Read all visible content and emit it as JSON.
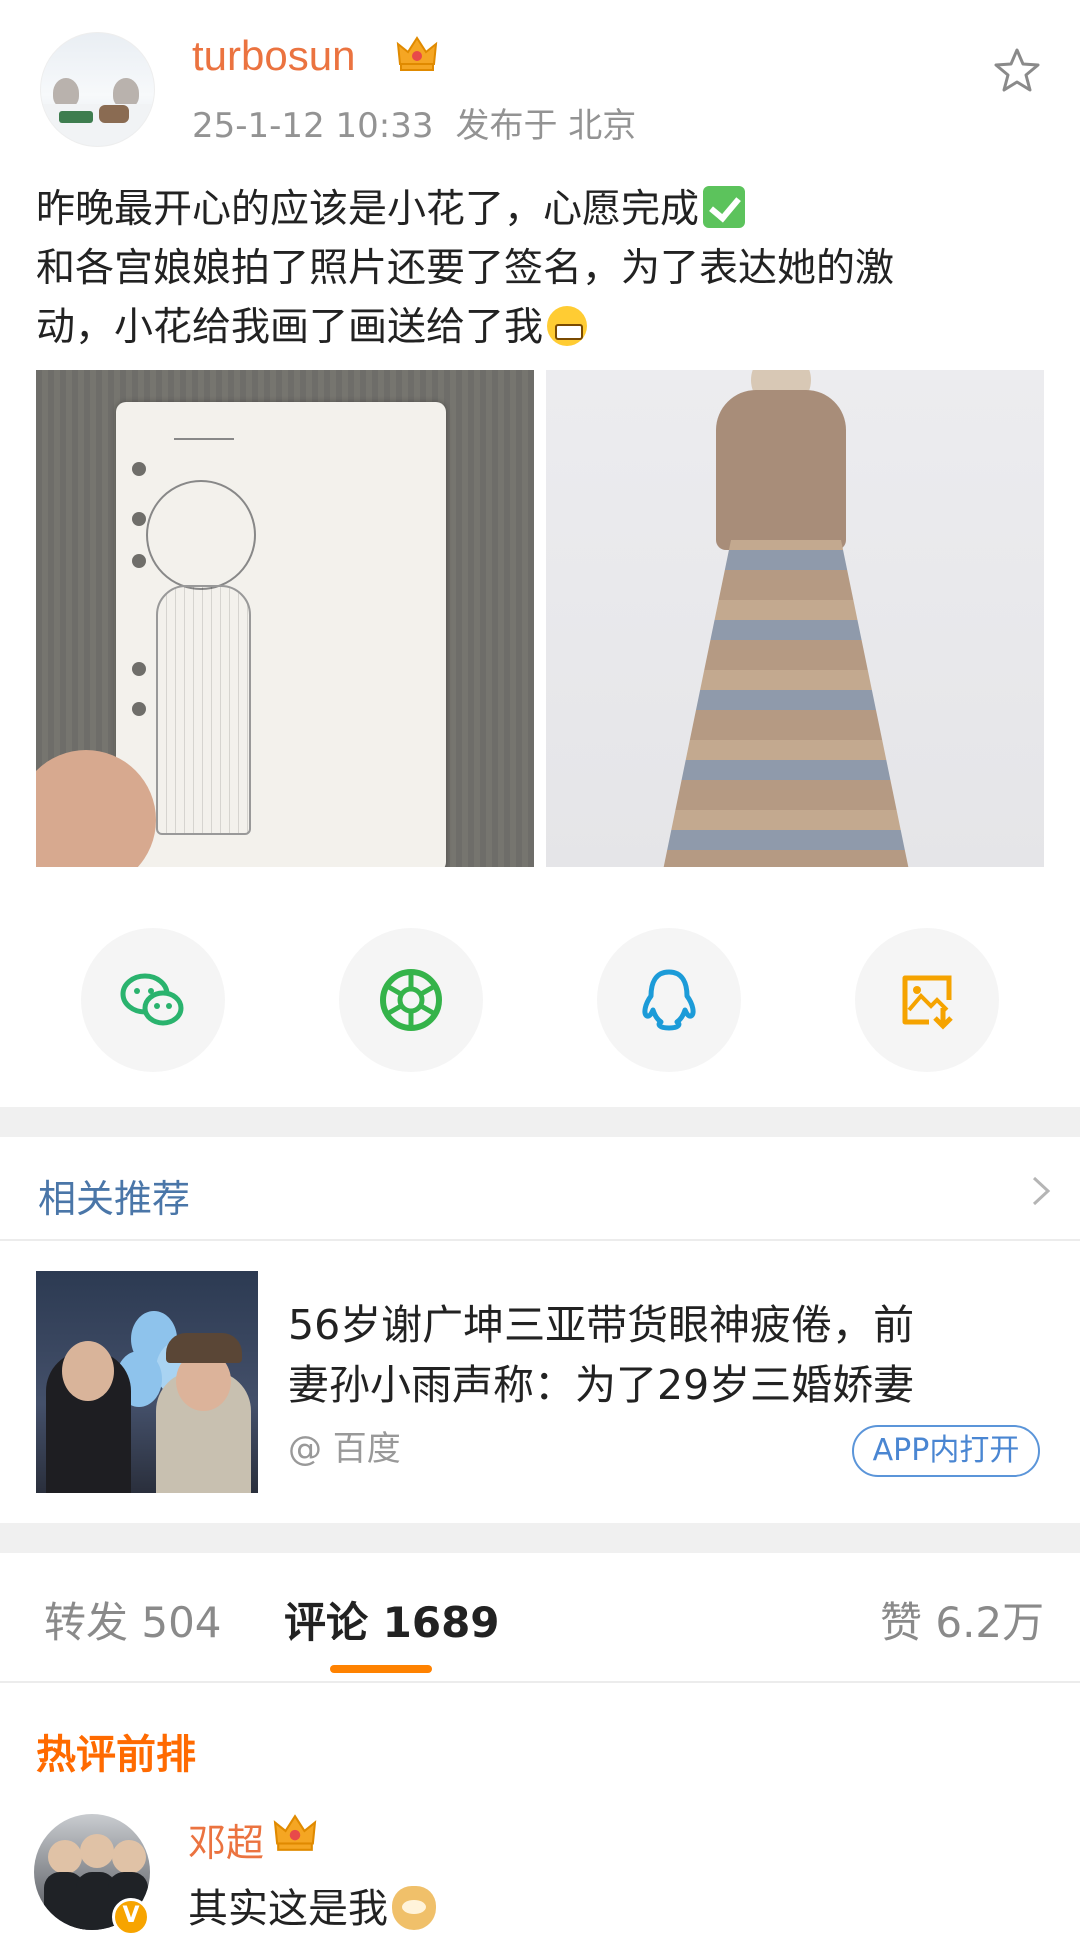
{
  "post": {
    "username": "turbosun",
    "datetime": "25-1-12 10:33",
    "location": "发布于 北京",
    "text_lines": [
      "昨晚最开心的应该是小花了，心愿完成",
      "和各宫娘娘拍了照片还要了签名，为了表达她的激",
      "动，小花给我画了画送给了我"
    ]
  },
  "share": {
    "icons": [
      "wechat-icon",
      "moments-icon",
      "qq-icon",
      "save-image-icon"
    ],
    "colors": {
      "wechat": "#2ab36e",
      "moments": "#35b34a",
      "qq": "#1c9bd8",
      "save": "#f5a300"
    }
  },
  "related": {
    "title": "相关推荐",
    "article": {
      "title_lines": [
        "56岁谢广坤三亚带货眼神疲倦，前",
        "妻孙小雨声称：为了29岁三婚娇妻"
      ],
      "source": "@ 百度",
      "open_button": "APP内打开"
    }
  },
  "tabs": {
    "repost": "转发 504",
    "comments": "评论 1689",
    "likes": "赞 6.2万",
    "active": "comments"
  },
  "hot_comments": {
    "title": "热评前排",
    "items": [
      {
        "name": "邓超",
        "text": "其实这是我"
      }
    ]
  },
  "colors": {
    "username": "#eb7340",
    "link_blue": "#4a76a8",
    "accent_orange": "#ff8200",
    "hot_title": "#ff6a00"
  }
}
